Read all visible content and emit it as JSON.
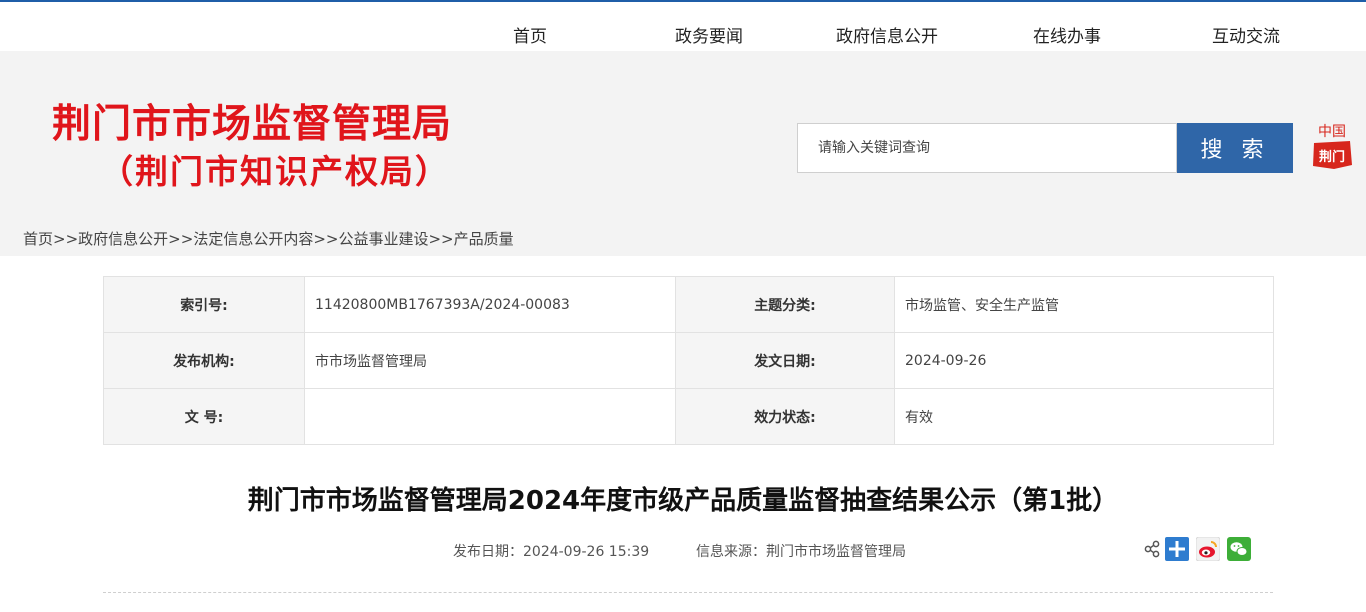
{
  "nav": {
    "items": [
      "首页",
      "政务要闻",
      "政府信息公开",
      "在线办事",
      "互动交流"
    ]
  },
  "header": {
    "title": "荆门市市场监督管理局",
    "subtitle": "（荆门市知识产权局）",
    "title_color": "#e0151b",
    "background": "#f3f3f3"
  },
  "search": {
    "placeholder": "请输入关键词查询",
    "button_label": "搜 索",
    "button_color": "#2f66a8"
  },
  "logo": {
    "text_top": "中国",
    "text_bottom": "荆门",
    "color": "#d7261c"
  },
  "breadcrumb": {
    "items": [
      "首页",
      "政府信息公开",
      "法定信息公开内容",
      "公益事业建设",
      "产品质量"
    ],
    "separator": ">>"
  },
  "info_table": {
    "rows": [
      {
        "label1": "索引号:",
        "value1": "11420800MB1767393A/2024-00083",
        "label2": "主题分类:",
        "value2": "市场监管、安全生产监管"
      },
      {
        "label1": "发布机构:",
        "value1": "市市场监督管理局",
        "label2": "发文日期:",
        "value2": "2024-09-26"
      },
      {
        "label1": "文 号:",
        "value1": "",
        "label2": "效力状态:",
        "value2": "有效"
      }
    ]
  },
  "article": {
    "title": "荆门市市场监督管理局2024年度市级产品质量监督抽查结果公示（第1批）",
    "publish_date": "发布日期：2024-09-26 15:39",
    "source": "信息来源：荆门市市场监督管理局"
  },
  "share": {
    "icons": [
      "share-icon",
      "plus-icon",
      "weibo-icon",
      "wechat-icon"
    ]
  }
}
